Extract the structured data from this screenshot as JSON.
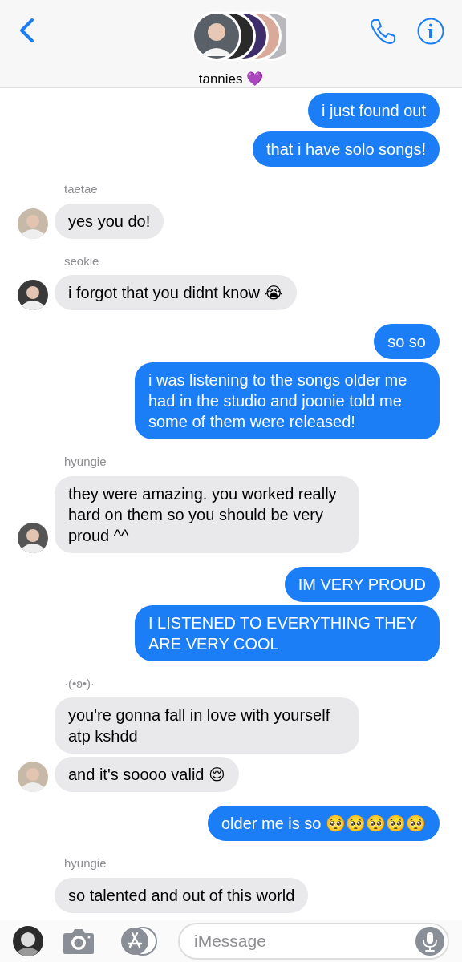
{
  "header": {
    "title": "tannies 💜"
  },
  "messages": [
    {
      "kind": "sent",
      "bubbles": [
        "i just found out",
        "that i have solo songs!"
      ]
    },
    {
      "kind": "received",
      "sender": "taetae",
      "avatar": true,
      "bubbles": [
        "yes you do!"
      ]
    },
    {
      "kind": "received",
      "sender": "seokie",
      "avatar": true,
      "bubbles": [
        "i forgot that you didnt know 😭"
      ]
    },
    {
      "kind": "sent",
      "bubbles": [
        "so so",
        "i was listening to the songs older me had in the studio and joonie told me some of them were released!"
      ]
    },
    {
      "kind": "received",
      "sender": "hyungie",
      "avatar": true,
      "bubbles": [
        "they were amazing. you worked really hard on them so you should be very proud ^^"
      ]
    },
    {
      "kind": "sent",
      "bubbles": [
        "IM VERY PROUD",
        "I LISTENED TO EVERYTHING THEY ARE VERY COOL"
      ]
    },
    {
      "kind": "received",
      "sender": "·(•ʚ•)·",
      "avatar": true,
      "bubbles": [
        "you're gonna fall in love with yourself atp kshdd",
        "and it's soooo valid 😌"
      ]
    },
    {
      "kind": "sent",
      "bubbles": [
        "older me is so 🥺🥺🥺🥺🥺"
      ]
    },
    {
      "kind": "received",
      "sender": "hyungie",
      "avatar": false,
      "bubbles": [
        "so talented and out of this world"
      ]
    }
  ],
  "composer": {
    "placeholder": "iMessage"
  }
}
